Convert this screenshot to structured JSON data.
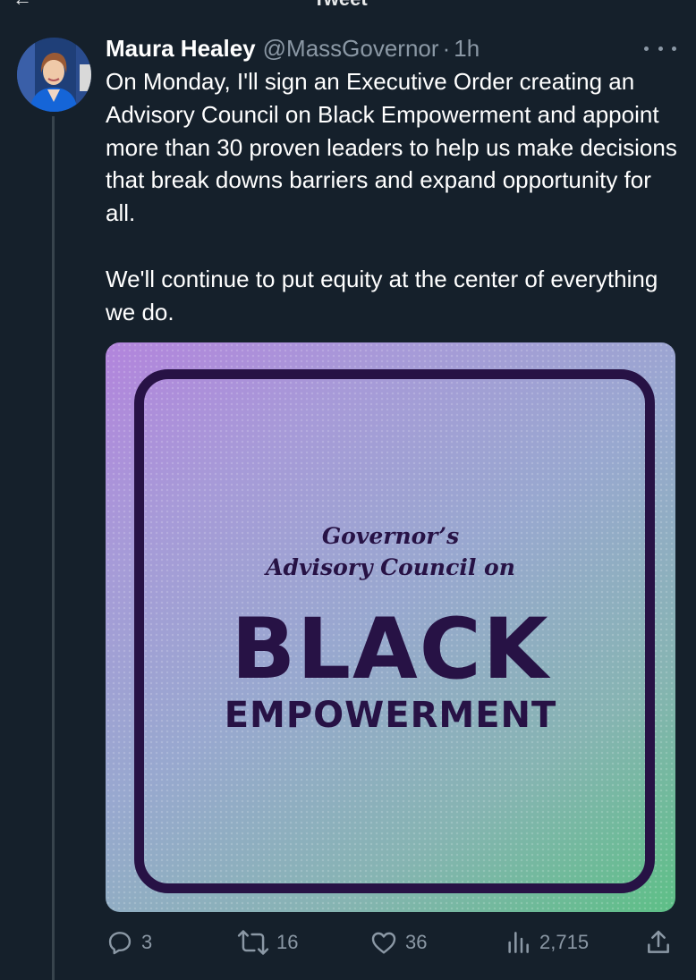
{
  "top_bar": {
    "title": "Tweet"
  },
  "tweet": {
    "author": {
      "display_name": "Maura Healey",
      "handle": "@MassGovernor",
      "separator": "·",
      "time": "1h"
    },
    "text_paragraphs": [
      "On Monday, I'll sign an Executive Order creating an Advisory Council on Black Empowerment and appoint more than 30 proven leaders to help us make decisions that break downs barriers and expand opportunity for all.",
      "We'll continue to put equity at the center of everything we do."
    ],
    "media": {
      "line1": "Governor’s",
      "line2": "Advisory Council on",
      "headline": "BLACK",
      "subheadline": "EMPOWERMENT"
    },
    "actions": {
      "replies": "3",
      "retweets": "16",
      "likes": "36",
      "views": "2,715"
    }
  },
  "icons": {
    "more": "more-icon",
    "reply": "reply-icon",
    "retweet": "retweet-icon",
    "like": "heart-icon",
    "views": "views-icon",
    "share": "share-icon"
  },
  "colors": {
    "background": "#15202b",
    "secondary_text": "#8b98a5",
    "primary_text": "#ffffff",
    "media_ink": "#271245"
  }
}
